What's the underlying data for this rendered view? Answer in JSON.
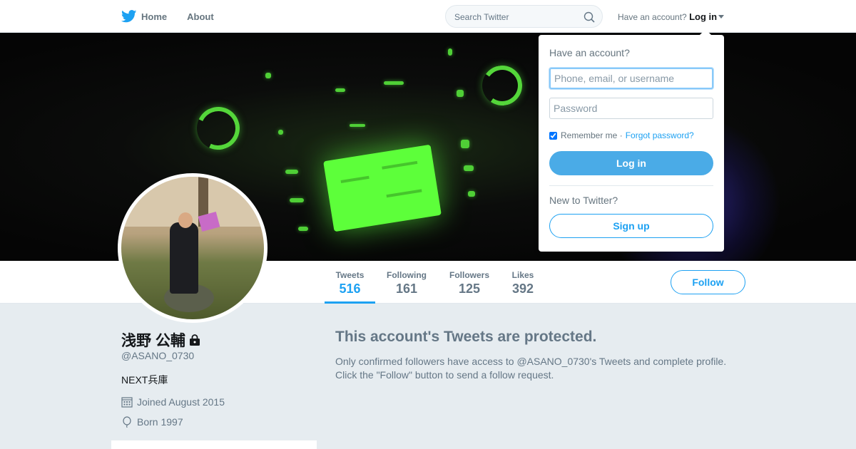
{
  "nav": {
    "home_label": "Home",
    "about_label": "About",
    "search_placeholder": "Search Twitter",
    "account_prompt": "Have an account?",
    "login_label": "Log in"
  },
  "profile": {
    "name": "浅野 公輔",
    "handle": "@ASANO_0730",
    "bio": "NEXT兵庫",
    "joined": "Joined August 2015",
    "born": "Born 1997"
  },
  "stats": [
    {
      "label": "Tweets",
      "value": "516"
    },
    {
      "label": "Following",
      "value": "161"
    },
    {
      "label": "Followers",
      "value": "125"
    },
    {
      "label": "Likes",
      "value": "392"
    }
  ],
  "follow_label": "Follow",
  "protected": {
    "title": "This account's Tweets are protected.",
    "line1": "Only confirmed followers have access to @ASANO_0730's Tweets and complete profile.",
    "line2": "Click the \"Follow\" button to send a follow request."
  },
  "login_dropdown": {
    "title": "Have an account?",
    "username_placeholder": "Phone, email, or username",
    "password_placeholder": "Password",
    "remember_label": "Remember me ·",
    "forgot_label": "Forgot password?",
    "login_button": "Log in",
    "new_prompt": "New to Twitter?",
    "signup_button": "Sign up"
  },
  "colors": {
    "accent": "#1da1f2",
    "login_button_bg": "#4aabe7",
    "page_bg": "#e6ecf0"
  }
}
